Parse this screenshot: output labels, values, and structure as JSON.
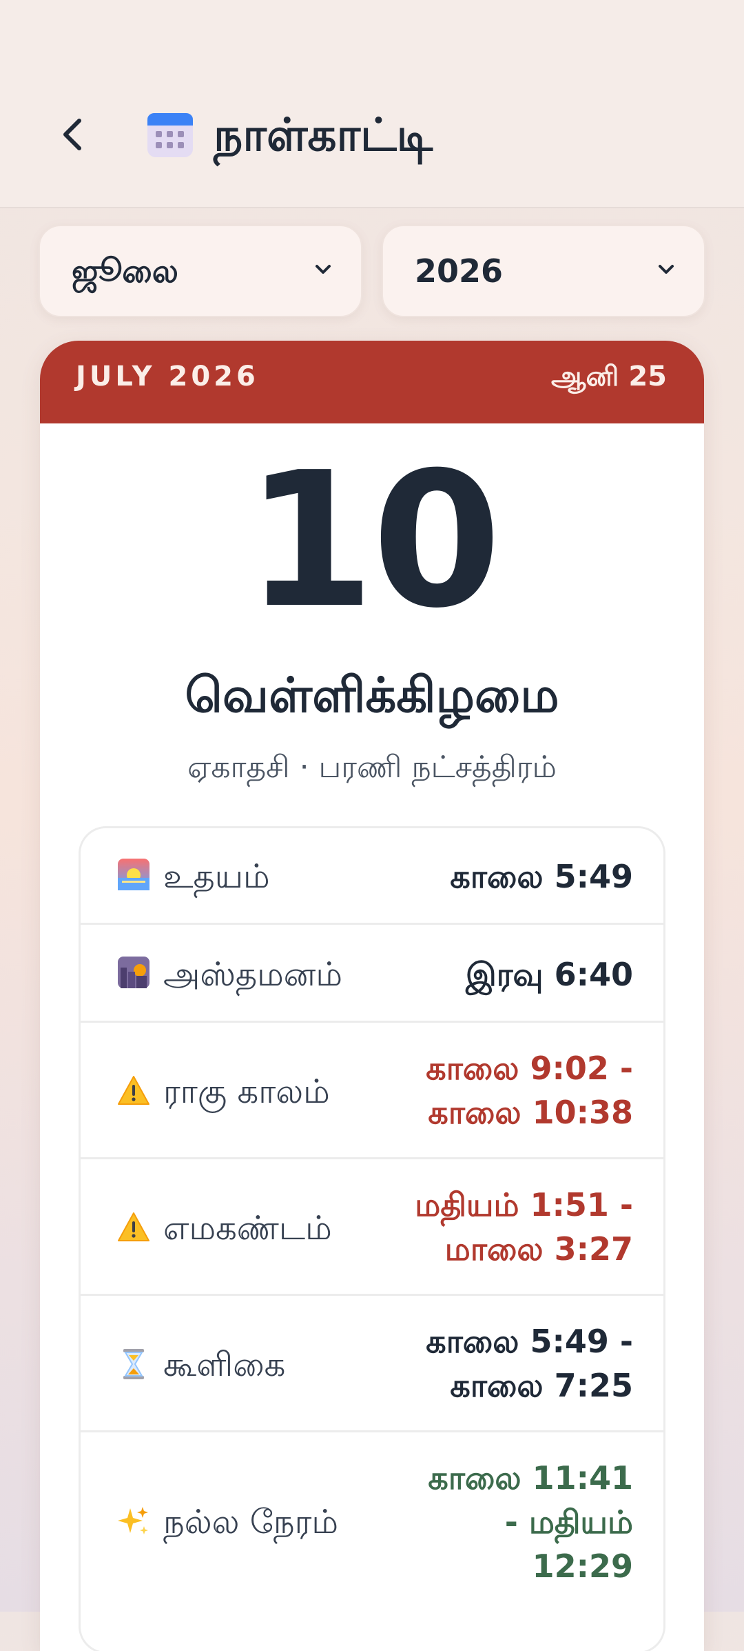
{
  "header": {
    "back_icon": "chevron-left-icon",
    "app_icon": "calendar-icon",
    "title": "நாள்காட்டி"
  },
  "filters": {
    "month": "ஜூலை",
    "year": "2026"
  },
  "card": {
    "english_month": "JULY 2026",
    "tamil_date": "ஆனி 25",
    "day": "10",
    "weekday": "வெள்ளிக்கிழமை",
    "subline": "ஏகாதசி · பரணி நட்சத்திரம்",
    "accent_color": "#b1392e"
  },
  "times": [
    {
      "icon": "sunrise-icon",
      "label": "உதயம்",
      "value_line1": "காலை 5:49",
      "value_line2": "",
      "value_line3": "",
      "tone": "neutral"
    },
    {
      "icon": "sunset-icon",
      "label": "அஸ்தமனம்",
      "value_line1": "இரவு 6:40",
      "value_line2": "",
      "value_line3": "",
      "tone": "neutral"
    },
    {
      "icon": "warning-icon",
      "label": "ராகு காலம்",
      "value_line1": "காலை 9:02 -",
      "value_line2": "காலை 10:38",
      "value_line3": "",
      "tone": "bad"
    },
    {
      "icon": "warning-icon",
      "label": "எமகண்டம்",
      "value_line1": "மதியம் 1:51 -",
      "value_line2": "மாலை 3:27",
      "value_line3": "",
      "tone": "bad"
    },
    {
      "icon": "hourglass-icon",
      "label": "கூளிகை",
      "value_line1": "காலை 5:49 -",
      "value_line2": "காலை 7:25",
      "value_line3": "",
      "tone": "neutral"
    },
    {
      "icon": "sparkles-icon",
      "label": "நல்ல நேரம்",
      "value_line1": "காலை 11:41",
      "value_line2": "- மதியம்",
      "value_line3": "12:29",
      "tone": "good"
    }
  ]
}
